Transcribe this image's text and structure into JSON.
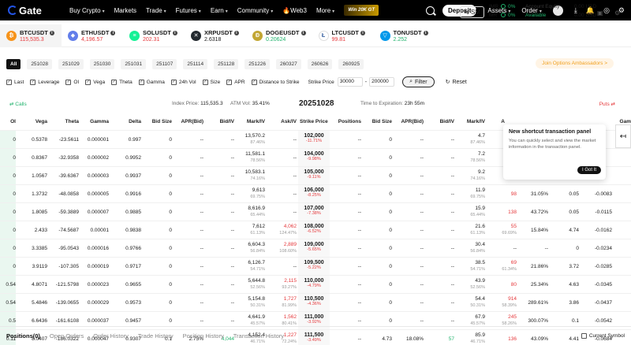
{
  "nav": {
    "logo": "Gate",
    "items": [
      {
        "label": "Buy Crypto",
        "chev": true
      },
      {
        "label": "Markets",
        "chev": false
      },
      {
        "label": "Trade",
        "chev": true
      },
      {
        "label": "Futures",
        "chev": true
      },
      {
        "label": "Earn",
        "chev": true
      },
      {
        "label": "Community",
        "chev": true
      }
    ],
    "web3": "Web3",
    "more": "More",
    "promo": "Win 20K GT",
    "deposit": "Deposit",
    "assets": "Assets",
    "order": "Order"
  },
  "tickers": [
    {
      "name": "BTCUSDT",
      "price": "115,535.3",
      "dir": "red",
      "color": "#f7931a",
      "glyph": "₿"
    },
    {
      "name": "ETHUSDT",
      "price": "4,196.57",
      "dir": "red",
      "color": "#627eea",
      "glyph": "◆"
    },
    {
      "name": "SOLUSDT",
      "price": "202.31",
      "dir": "red",
      "color": "#14f195",
      "glyph": "≡"
    },
    {
      "name": "XRPUSDT",
      "price": "2.6318",
      "dir": "none",
      "color": "#23292f",
      "glyph": "✕"
    },
    {
      "name": "DOGEUSDT",
      "price": "0.20624",
      "dir": "green",
      "color": "#c2a633",
      "glyph": "Ð"
    },
    {
      "name": "LTCUSDT",
      "price": "99.81",
      "dir": "red",
      "color": "#ffffff",
      "glyph": "Ł"
    },
    {
      "name": "TONUSDT",
      "price": "2.252",
      "dir": "green",
      "color": "#0098ea",
      "glyph": "▽"
    }
  ],
  "sm_label": "SM",
  "account": {
    "imr_label": "IMR",
    "imr_value": "0%",
    "mr_label": "MR",
    "mr_value": "0%",
    "equity_label": "Account Equity",
    "equity_value": "0.00 USD",
    "avail_label": "Available",
    "avail_value": "0.00 USD"
  },
  "expiries": {
    "all": "All",
    "dates": [
      "251028",
      "251029",
      "251030",
      "251031",
      "251107",
      "251114",
      "251128",
      "251226",
      "260327",
      "260626",
      "260925"
    ]
  },
  "ambassador": "Join Options Ambassadors >",
  "filters": {
    "checks": [
      "Last",
      "Leverage",
      "OI",
      "Vega",
      "Theta",
      "Gamma",
      "24h Vol",
      "Size",
      "APR",
      "Distance to Strike"
    ],
    "strike_label": "Strike Price",
    "strike_min": "30000",
    "strike_max": "200000",
    "filter_btn": "Filter",
    "reset_btn": "Reset"
  },
  "info": {
    "calls": "Calls",
    "puts": "Puts",
    "index_label": "Index Price:",
    "index_value": "115,535.3",
    "atm_label": "ATM Vol:",
    "atm_value": "35.41%",
    "date": "20251028",
    "tte_label": "Time to Expiration:",
    "tte_value": "23h 55m"
  },
  "headers": {
    "oi": "OI",
    "vega": "Vega",
    "theta": "Theta",
    "gamma": "Gamma",
    "delta": "Delta",
    "bidsize": "Bid Size",
    "aprbid": "APR(Bid)",
    "bidiv": "Bid/IV",
    "markiv": "Mark/IV",
    "askiv": "Ask/IV",
    "strike": "Strike Price",
    "positions": "Positions",
    "pbidsize": "Bid Size",
    "paprbid": "APR(Bid)",
    "pbidiv": "Bid/IV",
    "pmarkiv": "Mark/IV",
    "pa": "A",
    "pgam": "Gam"
  },
  "rows": [
    {
      "oi": "0",
      "vega": "0.5378",
      "theta": "-23.5611",
      "gamma": "0.000001",
      "delta": "0.997",
      "bidsize": "0",
      "aprbid": "--",
      "bidiv": "--",
      "mark": "13,570.2",
      "markiv": "87.46%",
      "ask": "--",
      "askiv": "--",
      "strike": "102,000",
      "pct": "-11.71%",
      "pos": "--",
      "pbs": "0",
      "papr": "--",
      "pbid": "--",
      "pmark": "4.7",
      "pmarkiv": "87.46%",
      "pa": "",
      "pa2": "",
      "pdelta": "",
      "pgam": ""
    },
    {
      "oi": "0",
      "vega": "0.8367",
      "theta": "-32.9358",
      "gamma": "0.000002",
      "delta": "0.9952",
      "bidsize": "0",
      "aprbid": "--",
      "bidiv": "--",
      "mark": "11,581.1",
      "markiv": "78.56%",
      "ask": "--",
      "askiv": "--",
      "strike": "104,000",
      "pct": "-9.98%",
      "pos": "--",
      "pbs": "0",
      "papr": "--",
      "pbid": "--",
      "pmark": "7.2",
      "pmarkiv": "78.56%",
      "pa": "",
      "pa2": "",
      "pdelta": "",
      "pgam": ""
    },
    {
      "oi": "0",
      "vega": "1.0567",
      "theta": "-39.6367",
      "gamma": "0.000003",
      "delta": "0.9937",
      "bidsize": "0",
      "aprbid": "--",
      "bidiv": "--",
      "mark": "10,583.1",
      "markiv": "74.16%",
      "ask": "--",
      "askiv": "--",
      "strike": "105,000",
      "pct": "-9.11%",
      "pos": "--",
      "pbs": "0",
      "papr": "--",
      "pbid": "--",
      "pmark": "9.2",
      "pmarkiv": "74.16%",
      "pa": "",
      "pa2": "",
      "pdelta": "",
      "pgam": ""
    },
    {
      "oi": "0",
      "vega": "1.3732",
      "theta": "-48.0858",
      "gamma": "0.000005",
      "delta": "0.9916",
      "bidsize": "0",
      "aprbid": "--",
      "bidiv": "--",
      "mark": "9,613",
      "markiv": "69.75%",
      "ask": "--",
      "askiv": "--",
      "strike": "106,000",
      "pct": "-8.25%",
      "pos": "--",
      "pbs": "0",
      "papr": "--",
      "pbid": "--",
      "pmark": "11.9",
      "pmarkiv": "69.75%",
      "pa": "98",
      "pa2": "",
      "pdelta": "31.05%",
      "pgam": "0.05"
    },
    {
      "oi": "0",
      "vega": "1.8085",
      "theta": "-59.3889",
      "gamma": "0.000007",
      "delta": "0.9885",
      "bidsize": "0",
      "aprbid": "--",
      "bidiv": "--",
      "mark": "8,616.9",
      "markiv": "65.44%",
      "ask": "--",
      "askiv": "--",
      "strike": "107,000",
      "pct": "-7.38%",
      "pos": "--",
      "pbs": "0",
      "papr": "--",
      "pbid": "--",
      "pmark": "15.9",
      "pmarkiv": "65.44%",
      "pa": "138",
      "pa2": "",
      "pdelta": "43.72%",
      "pgam": "0.05"
    },
    {
      "oi": "0",
      "vega": "2.433",
      "theta": "-74.5687",
      "gamma": "0.00001",
      "delta": "0.9838",
      "bidsize": "0",
      "aprbid": "--",
      "bidiv": "--",
      "mark": "7,612",
      "markiv": "61.13%",
      "ask": "4,062",
      "askiv": "124.47%",
      "strike": "108,000",
      "pct": "-6.52%",
      "pos": "--",
      "pbs": "0",
      "papr": "--",
      "pbid": "--",
      "pmark": "21.6",
      "pmarkiv": "61.13%",
      "pa": "55",
      "pa2": "69.69%",
      "pdelta": "15.84%",
      "pgam": "4.74"
    },
    {
      "oi": "0",
      "vega": "3.3385",
      "theta": "-95.0543",
      "gamma": "0.000016",
      "delta": "0.9766",
      "bidsize": "0",
      "aprbid": "--",
      "bidiv": "--",
      "mark": "6,604.3",
      "markiv": "56.84%",
      "ask": "2,889",
      "askiv": "108.60%",
      "strike": "109,000",
      "pct": "-5.65%",
      "pos": "--",
      "pbs": "0",
      "papr": "--",
      "pbid": "--",
      "pmark": "30.4",
      "pmarkiv": "56.84%",
      "pa": "--",
      "pa2": "--",
      "pdelta": "--",
      "pgam": "0"
    },
    {
      "oi": "0",
      "vega": "3.9119",
      "theta": "-107.305",
      "gamma": "0.000019",
      "delta": "0.9717",
      "bidsize": "0",
      "aprbid": "--",
      "bidiv": "--",
      "mark": "6,126.7",
      "markiv": "54.71%",
      "ask": "--",
      "askiv": "--",
      "strike": "109,500",
      "pct": "-5.22%",
      "pos": "--",
      "pbs": "0",
      "papr": "--",
      "pbid": "--",
      "pmark": "38.5",
      "pmarkiv": "54.71%",
      "pa": "69",
      "pa2": "61.34%",
      "pdelta": "21.86%",
      "pgam": "3.72"
    },
    {
      "oi": "0.54",
      "vega": "4.8071",
      "theta": "-121.5798",
      "gamma": "0.000023",
      "delta": "0.9655",
      "bidsize": "0",
      "aprbid": "--",
      "bidiv": "--",
      "mark": "5,644.8",
      "markiv": "52.56%",
      "ask": "2,115",
      "askiv": "93.27%",
      "strike": "110,000",
      "pct": "-4.79%",
      "pos": "--",
      "pbs": "0",
      "papr": "--",
      "pbid": "--",
      "pmark": "43.9",
      "pmarkiv": "52.56%",
      "pa": "80",
      "pa2": "",
      "pdelta": "25.34%",
      "pgam": "4.63"
    },
    {
      "oi": "0.54",
      "vega": "5.4846",
      "theta": "-139.0655",
      "gamma": "0.000029",
      "delta": "0.9573",
      "bidsize": "0",
      "aprbid": "--",
      "bidiv": "--",
      "mark": "5,154.8",
      "markiv": "50.31%",
      "ask": "1,727",
      "askiv": "81.99%",
      "strike": "110,500",
      "pct": "-4.36%",
      "pos": "--",
      "pbs": "0",
      "papr": "--",
      "pbid": "--",
      "pmark": "54.4",
      "pmarkiv": "50.31%",
      "pa": "914",
      "pa2": "58.39%",
      "pdelta": "289.61%",
      "pgam": "3.86"
    },
    {
      "oi": "0.5",
      "vega": "6.6436",
      "theta": "-161.6108",
      "gamma": "0.000037",
      "delta": "0.9457",
      "bidsize": "0",
      "aprbid": "--",
      "bidiv": "--",
      "mark": "4,641.9",
      "markiv": "45.57%",
      "ask": "1,562",
      "askiv": "80.41%",
      "strike": "111,000",
      "pct": "-3.92%",
      "pos": "--",
      "pbs": "0",
      "papr": "--",
      "pbid": "--",
      "pmark": "67.9",
      "pmarkiv": "45.57%",
      "pa": "245",
      "pa2": "58.26%",
      "pdelta": "300.07%",
      "pgam": "0.1"
    },
    {
      "oi": "0.11",
      "vega": "8.0407",
      "theta": "-186.0322",
      "gamma": "0.000047",
      "delta": "0.9307",
      "bidsize": "0.1",
      "aprbid": "2.75%",
      "bidiv": "4,044",
      "bidiv2": "",
      "mark": "4,152.4",
      "markiv": "46.71%",
      "ask": "1,227",
      "askiv": "72.24%",
      "strike": "111,500",
      "pct": "-3.49%",
      "pos": "--",
      "pbs": "4.73",
      "papr": "18.08%",
      "pbid": "57",
      "pmark": "85.9",
      "pmarkiv": "46.71%",
      "pa": "136",
      "pa2": "",
      "pdelta": "43.09%",
      "pgam": "4.41"
    }
  ],
  "put_extra_delta": [
    "",
    "",
    "",
    "-0.0083",
    "-0.0115",
    "-0.0162",
    "-0.0234",
    "-0.0285",
    "-0.0345",
    "-0.0437",
    "-0.0542",
    "-0.0684"
  ],
  "popover": {
    "title": "New shortcut transaction panel",
    "desc": "You can quickly select and view the market information in the transaction panel.",
    "button": "I Got It"
  },
  "bottom_tabs": [
    "Positions(0)",
    "Open Orders",
    "Order History",
    "Trade History",
    "Position History",
    "Transaction History"
  ],
  "current_symbol": "Current Symbol"
}
